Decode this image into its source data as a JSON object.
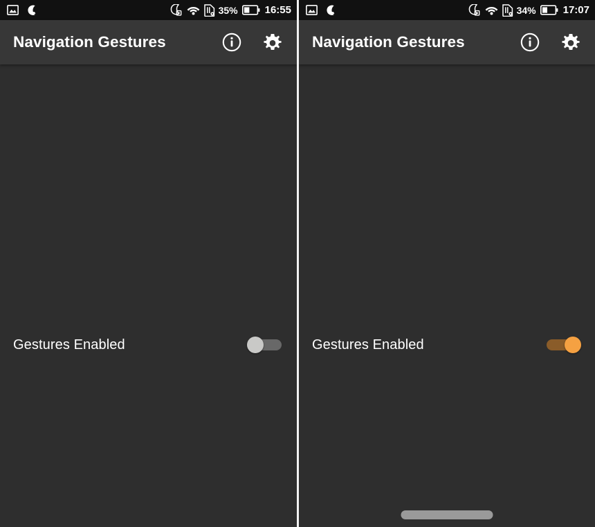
{
  "app": {
    "title": "Navigation Gestures"
  },
  "icons": {
    "photo": "photo-icon",
    "moon_call": "missed-call-moon-icon",
    "dnd": "do-not-disturb-moon-icon",
    "wifi": "wifi-icon",
    "sim": "sim-card-icon",
    "battery": "battery-icon",
    "info": "info-icon",
    "settings": "gear-icon"
  },
  "colors": {
    "status_bar_bg": "#111111",
    "app_bar_bg": "#373737",
    "content_bg": "#2e2e2e",
    "accent_on": "#f5a142",
    "track_on": "#8a5c29",
    "thumb_off": "#c9c9c7",
    "track_off": "#686868",
    "divider": "#f2f2f2",
    "gesture_pill": "#9a9a9a",
    "text_primary": "#ffffff"
  },
  "panels": [
    {
      "id": "left",
      "status_bar": {
        "battery_percent": "35%",
        "clock": "16:55"
      },
      "app_bar": {
        "title": "Navigation Gestures",
        "info_label": "Info",
        "settings_label": "Settings"
      },
      "preference": {
        "label": "Gestures Enabled",
        "switch_state": "off",
        "switch_state_label": "Off"
      },
      "gesture_pill_visible": false
    },
    {
      "id": "right",
      "status_bar": {
        "battery_percent": "34%",
        "clock": "17:07"
      },
      "app_bar": {
        "title": "Navigation Gestures",
        "info_label": "Info",
        "settings_label": "Settings"
      },
      "preference": {
        "label": "Gestures Enabled",
        "switch_state": "on",
        "switch_state_label": "On"
      },
      "gesture_pill_visible": true
    }
  ]
}
